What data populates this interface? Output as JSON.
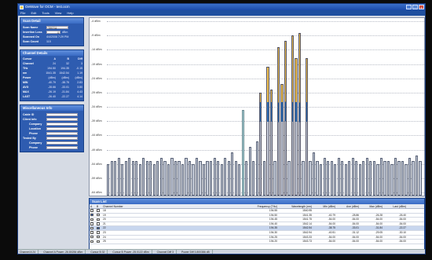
{
  "window": {
    "title": "OeWave for OCM - test.ocm",
    "close": "x",
    "minimize": "_",
    "maximize": "□"
  },
  "menu": [
    "File",
    "Edit",
    "Tools",
    "View",
    "Help"
  ],
  "scan_detail": {
    "title": "Scan Detail",
    "fields": [
      {
        "label": "Scan Name",
        "value": "TEST11",
        "type": "input"
      },
      {
        "label": "Insertion Loss",
        "value": "0",
        "unit": "dBm",
        "type": "input"
      },
      {
        "label": "Scanned On",
        "value": "4/4/2006 7:29 PM",
        "type": "text"
      },
      {
        "label": "Scan Count",
        "value": "115",
        "type": "text"
      }
    ]
  },
  "channel_details": {
    "title": "Channel Details",
    "header": [
      "Cursor",
      "A",
      "B",
      "Diff"
    ],
    "rows": [
      [
        "Channel",
        "24",
        "32",
        "3"
      ],
      [
        "THz",
        "194.50",
        "194.35",
        "-0.15"
      ],
      [
        "nm",
        "1541.35",
        "1542.54",
        "1.19"
      ],
      [
        "Power",
        "(dBm)",
        "(dBm)",
        "(dBm)"
      ],
      [
        "MIN",
        "-40.79",
        "-38.75",
        "2.83"
      ],
      [
        "AVG",
        "-28.66",
        "-33.01",
        "3.80"
      ],
      [
        "MAX",
        "-26.19",
        "-31.84",
        "4.43"
      ],
      [
        "LAST",
        "-26.40",
        "-22.27",
        "4.14"
      ]
    ]
  },
  "misc_info": {
    "title": "Miscellaneous Info",
    "fields": [
      "Cable ID",
      "Client Info",
      "Company",
      "Location",
      "Phone",
      "Tested By",
      "Company",
      "Phone"
    ]
  },
  "chart_data": {
    "type": "bar",
    "ylabel": "",
    "yticks": [
      "-4 dBm",
      "-9 dBm",
      "-14 dBm",
      "-19 dBm",
      "-24 dBm",
      "-29 dBm",
      "-34 dBm",
      "-39 dBm",
      "-44 dBm",
      "-49 dBm",
      "-54 dBm",
      "-59 dBm",
      "-64 dBm"
    ],
    "ylim": [
      -64,
      -4
    ],
    "colors": {
      "noise": "#c9cfdc",
      "noise_edge": "#5b6478",
      "peak_top": "#f0c050",
      "peak_mid": "#2f6fb8",
      "peak_low": "#c9cfdc",
      "marker": "#a8d0d8"
    },
    "values": [
      -54,
      -53,
      -53,
      -52,
      -54,
      -53,
      -52,
      -53,
      -53,
      -54,
      -52,
      -53,
      -53,
      -54,
      -53,
      -52,
      -53,
      -54,
      -52,
      -53,
      -53,
      -54,
      -52,
      -53,
      -54,
      -52,
      -53,
      -54,
      -53,
      -53,
      -52,
      -53,
      -54,
      -52,
      -53,
      -50,
      -53,
      -54,
      -35,
      -53,
      -48,
      -53,
      -46,
      -29,
      -53,
      -20,
      -28,
      -53,
      -13,
      -26,
      -11,
      -53,
      -9,
      -17,
      -8,
      -53,
      -17,
      -53,
      -50,
      -53,
      -54,
      -52,
      -53,
      -53,
      -54,
      -52,
      -53,
      -54,
      -53,
      -52,
      -53,
      -54,
      -53,
      -52,
      -53,
      -53,
      -54,
      -52,
      -53,
      -53,
      -54,
      -52,
      -53,
      -53,
      -54,
      -52,
      -53,
      -51,
      -53
    ],
    "highlight_index": [
      38
    ],
    "peak_index": [
      43,
      45,
      46,
      48,
      49,
      50,
      52,
      53,
      54,
      56
    ]
  },
  "scan_list": {
    "title": "Scan List",
    "columns": [
      "A",
      "B",
      "Channel Number",
      "Frequency (THz)",
      "Wavelength (nm)",
      "Min (dBm)",
      "Ave (dBm)",
      "Max (dBm)",
      "Last (dBm)"
    ],
    "rows": [
      {
        "a": false,
        "b": false,
        "ch": "18",
        "f": "194.55",
        "w": "1540.95",
        "min": "",
        "ave": "",
        "max": "",
        "last": ""
      },
      {
        "a": true,
        "b": false,
        "ch": "19",
        "f": "194.50",
        "w": "1541.35",
        "min": "-40.79",
        "ave": "-28.86",
        "max": "-26.28",
        "last": "-26.40"
      },
      {
        "a": false,
        "b": false,
        "ch": "20",
        "f": "194.45",
        "w": "1541.75",
        "min": "-54.00",
        "ave": "-54.00",
        "max": "-54.00",
        "last": "-54.00"
      },
      {
        "a": false,
        "b": false,
        "ch": "21",
        "f": "194.40",
        "w": "1542.14",
        "min": "-54.00",
        "ave": "-54.00",
        "max": "-54.00",
        "last": "-54.00"
      },
      {
        "a": false,
        "b": true,
        "ch": "22",
        "f": "194.35",
        "w": "1542.54",
        "min": "-38.75",
        "ave": "-33.01",
        "max": "-31.84",
        "last": "-22.27",
        "sel": true
      },
      {
        "a": false,
        "b": false,
        "ch": "23",
        "f": "194.30",
        "w": "1542.94",
        "min": "-40.51",
        "ave": "-31.12",
        "max": "-29.05",
        "last": "-30.10"
      },
      {
        "a": false,
        "b": false,
        "ch": "24",
        "f": "194.25",
        "w": "1543.33",
        "min": "-54.00",
        "ave": "-54.00",
        "max": "-54.00",
        "last": "-54.00"
      },
      {
        "a": false,
        "b": false,
        "ch": "25",
        "f": "194.20",
        "w": "1543.73",
        "min": "-54.00",
        "ave": "-54.00",
        "max": "-54.00",
        "last": "-54.00"
      }
    ]
  },
  "status": [
    "Channel A  24",
    "Channel A Power  -26.80284 dBm",
    "Cursor B  32",
    "Cursor B Power  -25.0122 dBm",
    "Channel Diff  3",
    "Power Diff  3.800386 dB"
  ]
}
